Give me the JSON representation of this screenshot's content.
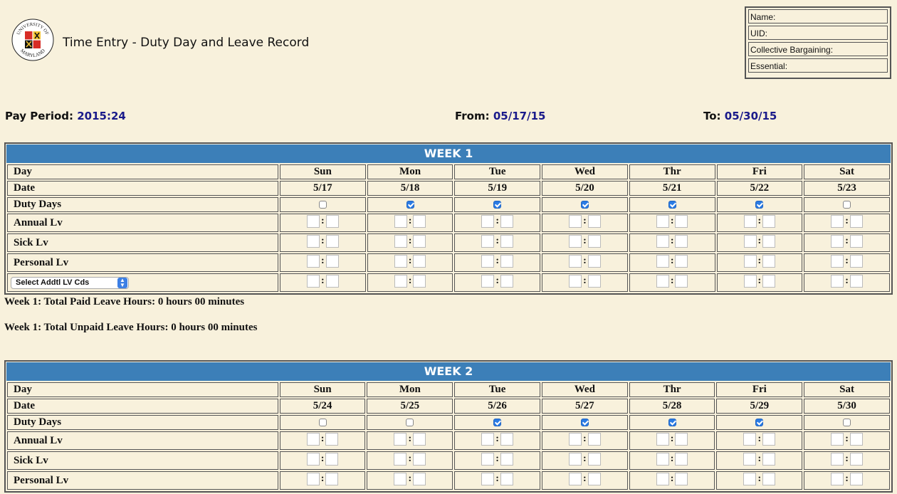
{
  "header": {
    "title": "Time Entry - Duty Day and Leave Record"
  },
  "logo": {
    "top_text": "UNIVERSITY OF",
    "bottom_text": "MARYLAND"
  },
  "info": {
    "name_label": "Name:",
    "uid_label": "UID:",
    "cb_label": "Collective Bargaining:",
    "essential_label": "Essential:"
  },
  "period": {
    "pay_label": "Pay Period:",
    "pay_value": "2015:24",
    "from_label": "From:",
    "from_value": "05/17/15",
    "to_label": "To:",
    "to_value": "05/30/15"
  },
  "labels": {
    "day": "Day",
    "date": "Date",
    "duty": "Duty Days",
    "annual": "Annual Lv",
    "sick": "Sick Lv",
    "personal": "Personal Lv",
    "select": "Select Addtl LV Cds"
  },
  "days": [
    "Sun",
    "Mon",
    "Tue",
    "Wed",
    "Thr",
    "Fri",
    "Sat"
  ],
  "colon": ":",
  "weeks": [
    {
      "title": "WEEK 1",
      "dates": [
        "5/17",
        "5/18",
        "5/19",
        "5/20",
        "5/21",
        "5/22",
        "5/23"
      ],
      "duty": [
        false,
        true,
        true,
        true,
        true,
        true,
        false
      ],
      "paid_summary": "Week 1: Total Paid Leave Hours: 0 hours 00 minutes",
      "unpaid_summary": "Week 1: Total Unpaid Leave Hours: 0 hours 00 minutes"
    },
    {
      "title": "WEEK 2",
      "dates": [
        "5/24",
        "5/25",
        "5/26",
        "5/27",
        "5/28",
        "5/29",
        "5/30"
      ],
      "duty": [
        false,
        false,
        true,
        true,
        true,
        true,
        false
      ]
    }
  ],
  "colors": {
    "week_header": "#3c7fb8",
    "background": "#f8f1dc",
    "value_text": "#1a1a8a"
  }
}
